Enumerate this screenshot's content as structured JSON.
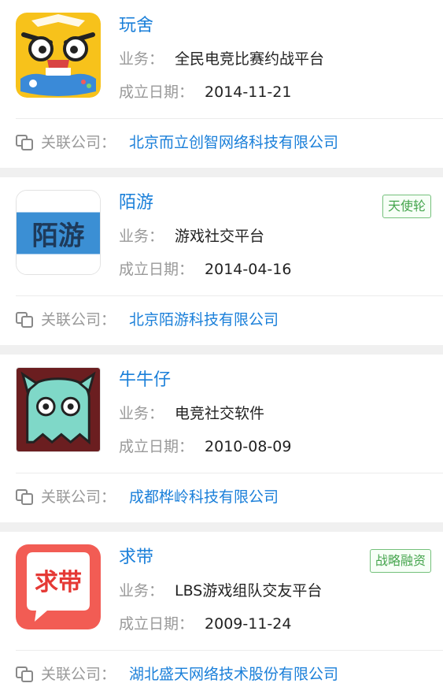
{
  "labels": {
    "business": "业务：",
    "founded": "成立日期：",
    "related": "关联公司："
  },
  "companies": [
    {
      "name": "玩舍",
      "business": "全民电竞比赛约战平台",
      "date": "2014-11-21",
      "badge": "",
      "related_company": "北京而立创智网络科技有限公司",
      "logo_icon": "angry-face-gamepad-icon"
    },
    {
      "name": "陌游",
      "business": "游戏社交平台",
      "date": "2014-04-16",
      "badge": "天使轮",
      "related_company": "北京陌游科技有限公司",
      "logo_icon": "moyou-text-logo",
      "logo_text": "陌游"
    },
    {
      "name": "牛牛仔",
      "business": "电竞社交软件",
      "date": "2010-08-09",
      "badge": "",
      "related_company": "成都桦岭科技有限公司",
      "logo_icon": "ghost-icon"
    },
    {
      "name": "求带",
      "business": "LBS游戏组队交友平台",
      "date": "2009-11-24",
      "badge": "战略融资",
      "related_company": "湖北盛天网络技术股份有限公司",
      "logo_icon": "speech-bubble-logo",
      "logo_text": "求带"
    }
  ],
  "colors": {
    "link": "#1a7fd9",
    "label": "#999999",
    "badge": "#46a54e"
  }
}
